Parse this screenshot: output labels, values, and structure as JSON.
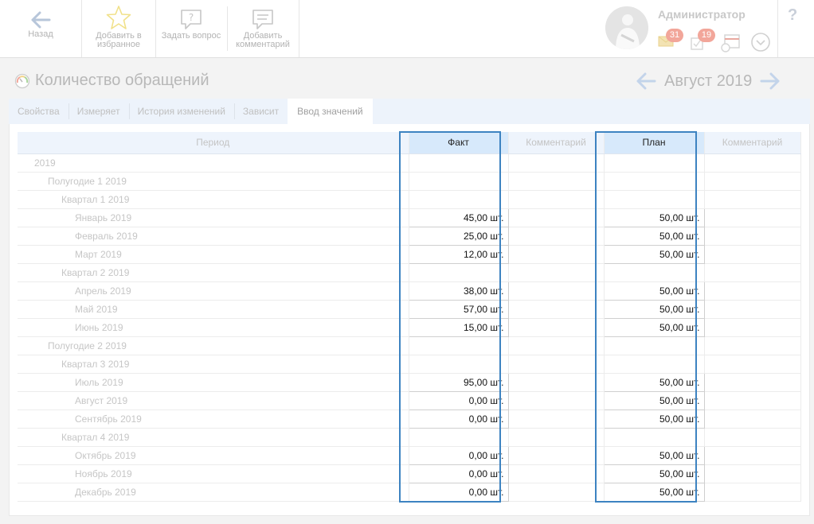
{
  "toolbar": {
    "back_label": "Назад",
    "favorite_label": "Добавить в избранное",
    "question_label": "Задать вопрос",
    "comment_label": "Добавить комментарий"
  },
  "user": {
    "name": "Администратор",
    "messages_count": "31",
    "tasks_count": "19"
  },
  "help_label": "?",
  "page": {
    "title": "Количество обращений",
    "period": "Август 2019"
  },
  "tabs": [
    {
      "label": "Свойства",
      "active": false
    },
    {
      "label": "Измеряет",
      "active": false
    },
    {
      "label": "История изменений",
      "active": false
    },
    {
      "label": "Зависит",
      "active": false
    },
    {
      "label": "Ввод значений",
      "active": true
    }
  ],
  "table": {
    "headers": {
      "period": "Период",
      "fact": "Факт",
      "fact_comment": "Комментарий",
      "plan": "План",
      "plan_comment": "Комментарий"
    },
    "rows": [
      {
        "period": "2019",
        "level": 0,
        "fact": "",
        "plan": ""
      },
      {
        "period": "Полугодие 1 2019",
        "level": 1,
        "fact": "",
        "plan": ""
      },
      {
        "period": "Квартал 1 2019",
        "level": 2,
        "fact": "",
        "plan": ""
      },
      {
        "period": "Январь 2019",
        "level": 3,
        "fact": "45,00 шт.",
        "plan": "50,00 шт."
      },
      {
        "period": "Февраль 2019",
        "level": 3,
        "fact": "25,00 шт.",
        "plan": "50,00 шт."
      },
      {
        "period": "Март 2019",
        "level": 3,
        "fact": "12,00 шт.",
        "plan": "50,00 шт."
      },
      {
        "period": "Квартал 2 2019",
        "level": 2,
        "fact": "",
        "plan": ""
      },
      {
        "period": "Апрель 2019",
        "level": 3,
        "fact": "38,00 шт.",
        "plan": "50,00 шт."
      },
      {
        "period": "Май 2019",
        "level": 3,
        "fact": "57,00 шт.",
        "plan": "50,00 шт."
      },
      {
        "period": "Июнь 2019",
        "level": 3,
        "fact": "15,00 шт.",
        "plan": "50,00 шт."
      },
      {
        "period": "Полугодие 2 2019",
        "level": 1,
        "fact": "",
        "plan": ""
      },
      {
        "period": "Квартал 3 2019",
        "level": 2,
        "fact": "",
        "plan": ""
      },
      {
        "period": "Июль 2019",
        "level": 3,
        "fact": "95,00 шт.",
        "plan": "50,00 шт."
      },
      {
        "period": "Август 2019",
        "level": 3,
        "fact": "0,00 шт.",
        "plan": "50,00 шт."
      },
      {
        "period": "Сентябрь 2019",
        "level": 3,
        "fact": "0,00 шт.",
        "plan": "50,00 шт."
      },
      {
        "period": "Квартал 4 2019",
        "level": 2,
        "fact": "",
        "plan": ""
      },
      {
        "period": "Октябрь 2019",
        "level": 3,
        "fact": "0,00 шт.",
        "plan": "50,00 шт."
      },
      {
        "period": "Ноябрь 2019",
        "level": 3,
        "fact": "0,00 шт.",
        "plan": "50,00 шт."
      },
      {
        "period": "Декабрь 2019",
        "level": 3,
        "fact": "0,00 шт.",
        "plan": "50,00 шт."
      }
    ]
  },
  "colors": {
    "highlight_frame": "#3d83c1",
    "header_bg": "#eef4fc",
    "badge": "#f2a69a"
  }
}
